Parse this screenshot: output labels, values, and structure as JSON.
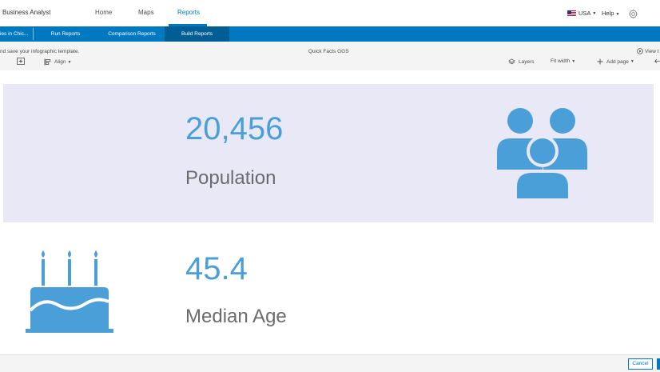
{
  "app": {
    "title": "Business Analyst"
  },
  "nav": {
    "home": "Home",
    "maps": "Maps",
    "reports": "Reports"
  },
  "header": {
    "locale": "USA",
    "help": "Help"
  },
  "subnav": {
    "project": "ies in Chic...",
    "run_reports": "Run Reports",
    "comparison_reports": "Comparison Reports",
    "build_reports": "Build Reports"
  },
  "toolbar": {
    "hint": "nd save your infographic template.",
    "report_name": "Quick Facts GGS",
    "view_label": "View t",
    "align": "Align",
    "layers": "Layers",
    "fit_width": "Fit width",
    "add_page": "Add page"
  },
  "stats": {
    "population": {
      "value": "20,456",
      "label": "Population"
    },
    "median_age": {
      "value": "45.4",
      "label": "Median Age"
    }
  },
  "footer": {
    "cancel": "Cancel"
  },
  "colors": {
    "accent": "#0079c1",
    "stat_blue": "#4a9fd8",
    "card_bg": "#e8e8f6"
  }
}
